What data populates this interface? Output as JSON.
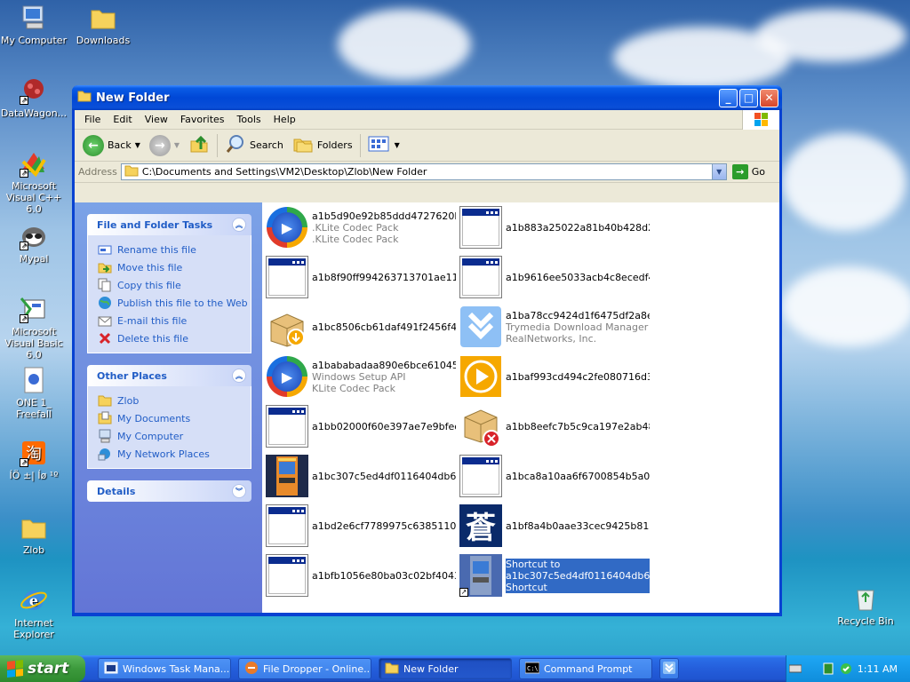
{
  "desktop": {
    "icons": [
      {
        "label": "My Computer"
      },
      {
        "label": "Downloads"
      },
      {
        "label": "DataWagon..."
      },
      {
        "label": "Microsoft Visual C++ 6.0"
      },
      {
        "label": "Mypal"
      },
      {
        "label": "Microsoft Visual Basic 6.0"
      },
      {
        "label": "ONE 1_ Freefall"
      },
      {
        "label": "ÍÖ ±| Íø ¹º"
      },
      {
        "label": "Zlob"
      },
      {
        "label": "Internet Explorer"
      },
      {
        "label": "Recycle Bin"
      }
    ]
  },
  "window": {
    "title": "New Folder",
    "menu": [
      "File",
      "Edit",
      "View",
      "Favorites",
      "Tools",
      "Help"
    ],
    "toolbar": {
      "back": "Back",
      "search": "Search",
      "folders": "Folders"
    },
    "address": {
      "label": "Address",
      "value": "C:\\Documents and Settings\\VM2\\Desktop\\Zlob\\New Folder",
      "go": "Go"
    },
    "tasks": {
      "title": "File and Folder Tasks",
      "items": [
        "Rename this file",
        "Move this file",
        "Copy this file",
        "Publish this file to the Web",
        "E-mail this file",
        "Delete this file"
      ]
    },
    "places": {
      "title": "Other Places",
      "items": [
        "Zlob",
        "My Documents",
        "My Computer",
        "My Network Places"
      ]
    },
    "details": {
      "title": "Details"
    },
    "files": [
      {
        "name": "a1b5d90e92b85ddd4727620b...",
        "l2": ".KLite Codec Pack",
        "l3": ".KLite Codec Pack",
        "icon": "media-player-icon"
      },
      {
        "name": "a1b883a25022a81b40b428d2...",
        "l2": "",
        "l3": "",
        "icon": "window-app-icon"
      },
      {
        "name": "a1b8f90ff994263713701ae11...",
        "l2": "",
        "l3": "",
        "icon": "window-app-icon"
      },
      {
        "name": "a1b9616ee5033acb4c8ecedf4...",
        "l2": "",
        "l3": "",
        "icon": "window-app-icon"
      },
      {
        "name": "a1bc8506cb61daf491f2456f4...",
        "l2": "",
        "l3": "",
        "icon": "installer-box-icon"
      },
      {
        "name": "a1ba78cc9424d1f6475df2a8e...",
        "l2": "Trymedia Download Manager",
        "l3": "RealNetworks, Inc.",
        "icon": "download-manager-icon"
      },
      {
        "name": "a1bababadaa890e6bce610451d...",
        "l2": "Windows Setup API",
        "l3": "KLite Codec Pack",
        "icon": "media-player-icon"
      },
      {
        "name": "a1baf993cd494c2fe080716d3...",
        "l2": "",
        "l3": "",
        "icon": "orange-play-icon"
      },
      {
        "name": "a1bb02000f60e397ae7e9bfed...",
        "l2": "",
        "l3": "",
        "icon": "window-app-icon"
      },
      {
        "name": "a1bb8eefc7b5c9ca197e2ab48...",
        "l2": "",
        "l3": "",
        "icon": "installer-error-icon"
      },
      {
        "name": "a1bc307c5ed4df0116404db65...",
        "l2": "",
        "l3": "",
        "icon": "arcade-cabinet-icon"
      },
      {
        "name": "a1bca8a10aa6f6700854b5a0...",
        "l2": "",
        "l3": "",
        "icon": "window-app-icon"
      },
      {
        "name": "a1bd2e6cf7789975c6385110a...",
        "l2": "",
        "l3": "",
        "icon": "window-app-icon"
      },
      {
        "name": "a1bf8a4b0aae33cec9425b816...",
        "l2": "",
        "l3": "",
        "icon": "kanji-icon"
      },
      {
        "name": "a1bfb1056e80ba03c02bf4043...",
        "l2": "",
        "l3": "",
        "icon": "window-app-icon"
      },
      {
        "name": "Shortcut to",
        "l2": "a1bc307c5ed4df0116404db65...",
        "l3": "Shortcut",
        "icon": "arcade-shortcut-icon"
      }
    ],
    "kanji": "蒼"
  },
  "taskbar": {
    "start": "start",
    "tasks": [
      {
        "label": "Windows Task Mana..."
      },
      {
        "label": "File Dropper - Online..."
      },
      {
        "label": "New Folder"
      },
      {
        "label": "Command Prompt"
      }
    ],
    "clock": "1:11 AM"
  },
  "colors": {
    "xp_blue": "#0842d2",
    "link": "#215dc6",
    "select": "#316ac5"
  }
}
